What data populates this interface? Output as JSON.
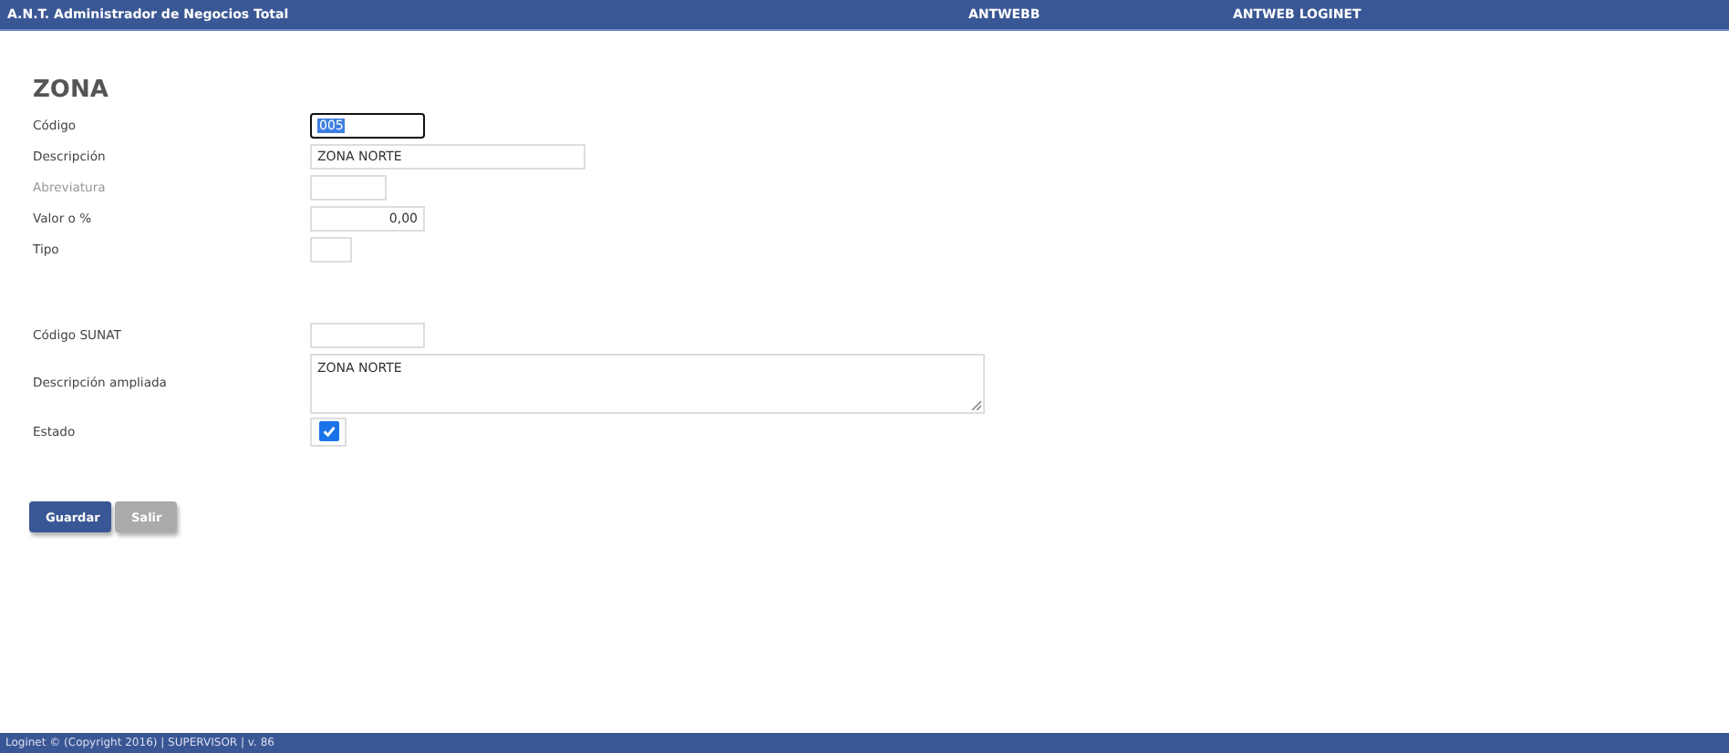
{
  "header": {
    "app_title": "A.N.T. Administrador de Negocios Total",
    "items": [
      "ANTWEBB",
      "ANTWEB LOGINET"
    ]
  },
  "form": {
    "title": "ZONA",
    "sections": [
      [
        {
          "label": "Código",
          "kind": "text",
          "value": "005",
          "focused": true,
          "muted": false
        },
        {
          "label": "Descripción",
          "kind": "text",
          "value": "ZONA NORTE",
          "focused": false,
          "muted": false
        },
        {
          "label": "Abreviatura",
          "kind": "text",
          "focused": false,
          "muted": true
        },
        {
          "label": "Valor o %",
          "kind": "number",
          "value": "0,00",
          "focused": false,
          "muted": false
        },
        {
          "label": "Tipo",
          "kind": "text",
          "focused": false,
          "muted": false
        }
      ],
      [
        {
          "label": "Código SUNAT",
          "kind": "text",
          "focused": false,
          "muted": false
        },
        {
          "label": "Descripción ampliada",
          "kind": "textarea",
          "value": "ZONA NORTE",
          "focused": false,
          "muted": false
        },
        {
          "label": "Estado",
          "kind": "checkbox",
          "checked": true,
          "muted": false
        }
      ]
    ],
    "buttons": [
      {
        "label": "Guardar",
        "kind": "primary"
      },
      {
        "label": "Salir",
        "kind": "secondary"
      }
    ]
  },
  "footer": "Loginet © (Copyright 2016) | SUPERVISOR | v. 86"
}
